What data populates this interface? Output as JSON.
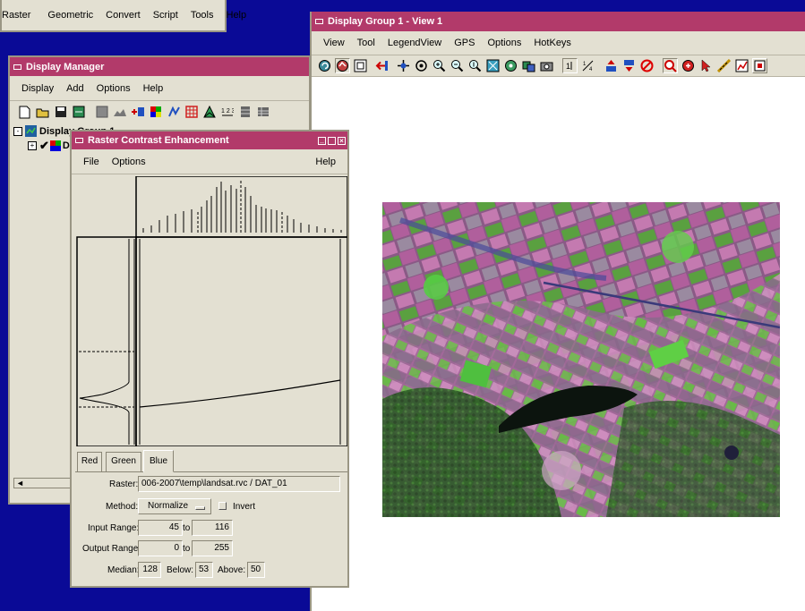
{
  "app_menu": {
    "items": [
      "Raster",
      "Geometric",
      "Convert",
      "Script",
      "Tools",
      "Help"
    ]
  },
  "display_manager": {
    "title": "Display Manager",
    "menu": [
      "Display",
      "Add",
      "Options",
      "Help"
    ],
    "tree": {
      "group_label": "Display Group 1",
      "layer_label": "D"
    }
  },
  "rce": {
    "title": "Raster Contrast Enhancement",
    "menu": {
      "file": "File",
      "options": "Options",
      "help": "Help"
    },
    "tabs": [
      "Red",
      "Green",
      "Blue"
    ],
    "active_tab": "Blue",
    "raster_label": "Raster:",
    "raster_value": "006-2007\\temp\\landsat.rvc / DAT_01",
    "method_label": "Method:",
    "method_value": "Normalize",
    "invert_label": "Invert",
    "input_range_label": "Input Range:",
    "input_min": "45",
    "input_max": "116",
    "output_range_label": "Output Range:",
    "output_min": "0",
    "output_max": "255",
    "to_label": "to",
    "median_label": "Median:",
    "median_value": "128",
    "below_label": "Below:",
    "below_value": "53",
    "above_label": "Above:",
    "above_value": "50"
  },
  "view": {
    "title": "Display Group 1 - View 1",
    "menu": [
      "View",
      "Tool",
      "LegendView",
      "GPS",
      "Options",
      "HotKeys"
    ]
  },
  "colors": {
    "title_bar": "#b23a6a",
    "desktop": "#0a0a96",
    "window_face": "#e3e0d2"
  }
}
